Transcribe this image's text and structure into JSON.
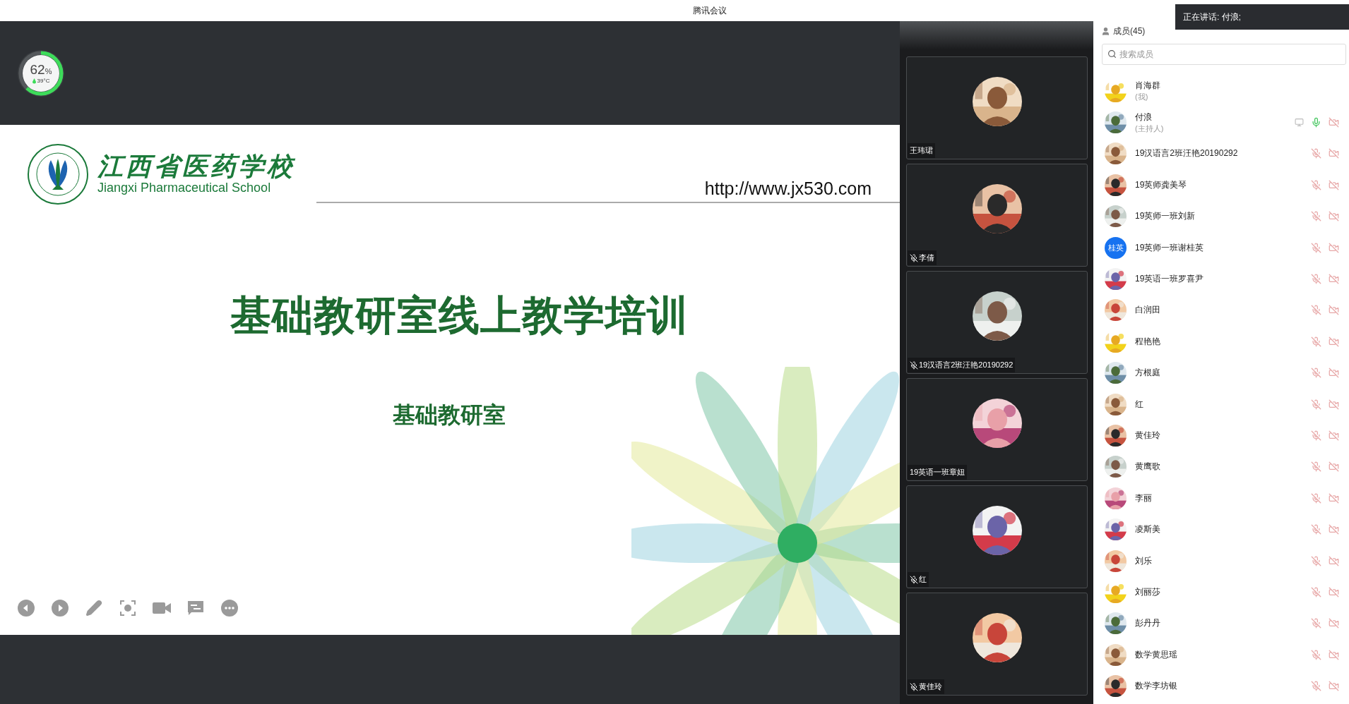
{
  "window": {
    "title": "腾讯会议"
  },
  "gauge": {
    "value": "62",
    "unit": "%",
    "temperature": "39°C",
    "level": 0.62
  },
  "slide": {
    "school_cn": "江西省医药学校",
    "school_en": "Jiangxi Pharmaceutical School",
    "url": "http://www.jx530.com",
    "title": "基础教研室线上教学培训",
    "subtitle": "基础教研室"
  },
  "slide_toolbar": [
    {
      "kind": "prev"
    },
    {
      "kind": "next"
    },
    {
      "kind": "pen"
    },
    {
      "kind": "focus"
    },
    {
      "kind": "camera"
    },
    {
      "kind": "chat"
    },
    {
      "kind": "more"
    }
  ],
  "video_tiles": [
    {
      "name": "王玮珺",
      "muted": false
    },
    {
      "name": "李倩",
      "muted": true
    },
    {
      "name": "19汉语言2班汪艳20190292",
      "muted": true
    },
    {
      "name": "19英语一班章妞",
      "muted": false
    },
    {
      "name": "红",
      "muted": true
    },
    {
      "name": "黄佳玲",
      "muted": true
    }
  ],
  "speaking_toast": {
    "text": "正在讲话: 付浪;"
  },
  "members_panel": {
    "title": "成员(45)",
    "search": {
      "placeholder": "搜索成员"
    },
    "members": [
      {
        "name": "肖海群",
        "role": "(我)"
      },
      {
        "name": "付浪",
        "role": "(主持人)",
        "sharing": true,
        "muted": false,
        "camera_on": false
      },
      {
        "name": "19汉语言2班汪艳20190292",
        "muted": true,
        "camera_on": false
      },
      {
        "name": "19英师龚美琴",
        "muted": true,
        "camera_on": false
      },
      {
        "name": "19英师一班刘新",
        "muted": true,
        "camera_on": false
      },
      {
        "name": "19英师一班谢桂英",
        "avatar": {
          "kind": "text",
          "text": "桂英"
        },
        "muted": true,
        "camera_on": false
      },
      {
        "name": "19英语一班罗喜尹",
        "muted": true,
        "camera_on": false
      },
      {
        "name": "白润田",
        "muted": true,
        "camera_on": false
      },
      {
        "name": "程艳艳",
        "muted": true,
        "camera_on": false
      },
      {
        "name": "方根庭",
        "muted": true,
        "camera_on": false
      },
      {
        "name": "红",
        "muted": true,
        "camera_on": false
      },
      {
        "name": "黄佳玲",
        "muted": true,
        "camera_on": false
      },
      {
        "name": "黄鹰歌",
        "muted": true,
        "camera_on": false
      },
      {
        "name": "李丽",
        "muted": true,
        "camera_on": false
      },
      {
        "name": "凌斯美",
        "muted": true,
        "camera_on": false
      },
      {
        "name": "刘乐",
        "muted": true,
        "camera_on": false
      },
      {
        "name": "刘丽莎",
        "muted": true,
        "camera_on": false
      },
      {
        "name": "彭丹丹",
        "muted": true,
        "camera_on": false
      },
      {
        "name": "数学黄思瑶",
        "muted": true,
        "camera_on": false
      },
      {
        "name": "数学李坊银",
        "muted": true,
        "camera_on": false
      }
    ]
  }
}
